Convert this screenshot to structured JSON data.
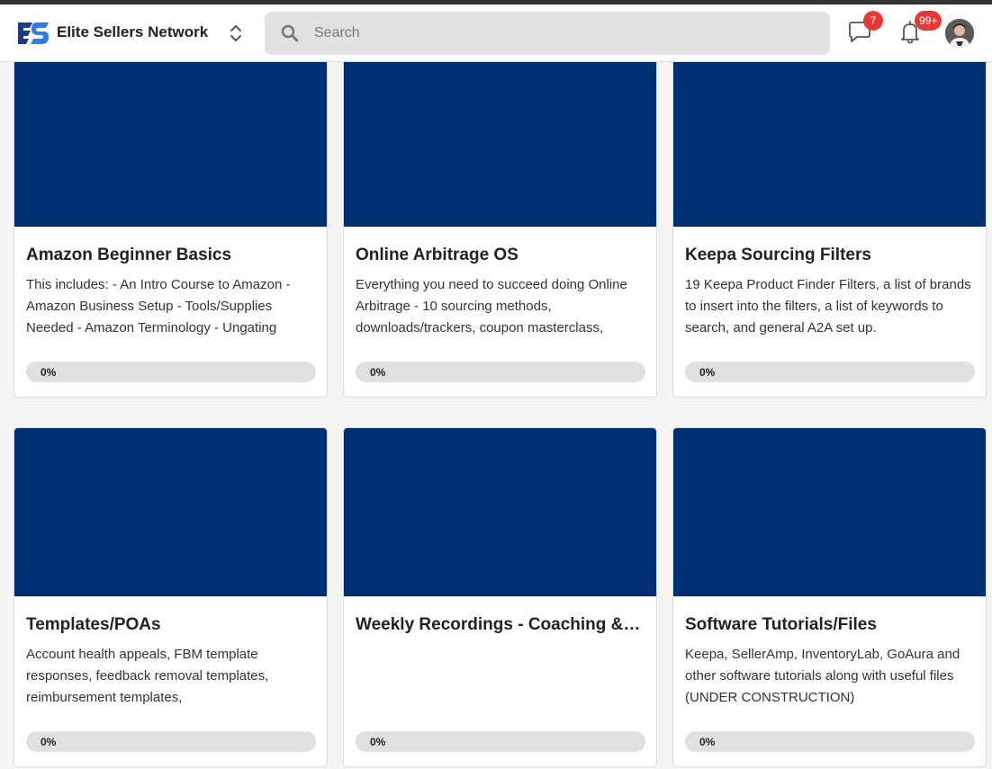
{
  "app": {
    "brand_name": "Elite Sellers Network",
    "accent_color": "#002e72"
  },
  "header": {
    "search": {
      "placeholder": "Search",
      "value": ""
    },
    "messages_badge": "7",
    "notifications_badge": "99+",
    "badge_color": "#e53935"
  },
  "courses": [
    {
      "title": "Amazon Beginner Basics",
      "description": "This includes: - An Intro Course to Amazon - Amazon Business Setup - Tools/Supplies Needed - Amazon Terminology - Ungating",
      "progress_label": "0%",
      "progress": 0
    },
    {
      "title": "Online Arbitrage OS",
      "description": "Everything you need to succeed doing Online Arbitrage - 10 sourcing methods, downloads/trackers, coupon masterclass,",
      "progress_label": "0%",
      "progress": 0
    },
    {
      "title": "Keepa Sourcing Filters",
      "description": "19 Keepa Product Finder Filters, a list of brands to insert into the filters, a list of keywords to search, and general A2A set up.",
      "progress_label": "0%",
      "progress": 0
    },
    {
      "title": "Templates/POAs",
      "description": "Account health appeals, FBM template responses, feedback removal templates, reimbursement templates,",
      "progress_label": "0%",
      "progress": 0
    },
    {
      "title": "Weekly Recordings - Coaching & …",
      "description": "",
      "progress_label": "0%",
      "progress": 0
    },
    {
      "title": "Software Tutorials/Files",
      "description": "Keepa, SellerAmp, InventoryLab, GoAura and other software tutorials along with useful files (UNDER CONSTRUCTION)",
      "progress_label": "0%",
      "progress": 0
    }
  ]
}
